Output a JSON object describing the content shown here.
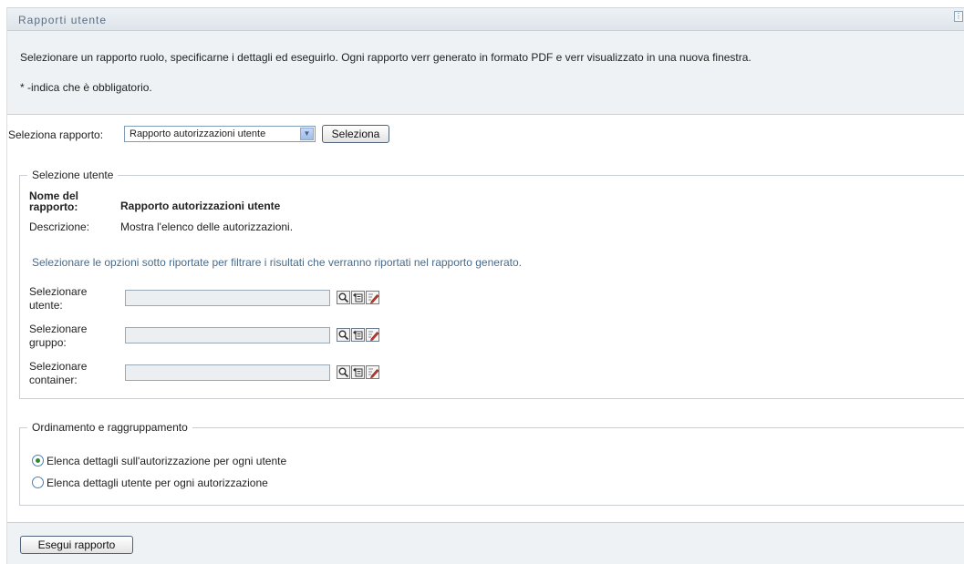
{
  "window": {
    "title": "Rapporti utente"
  },
  "intro": {
    "description": "Selezionare un rapporto ruolo, specificarne i dettagli ed eseguirlo. Ogni rapporto verr generato in formato PDF e verr visualizzato in una nuova finestra.",
    "required_note": "* -indica che è obbligatorio."
  },
  "report_select": {
    "label": "Seleziona rapporto:",
    "selected_value": "Rapporto autorizzazioni utente",
    "button_label": "Seleziona"
  },
  "user_selection": {
    "legend": "Selezione utente",
    "name_label_line1": "Nome del",
    "name_label_line2": "rapporto:",
    "name_value": "Rapporto autorizzazioni utente",
    "description_label": "Descrizione:",
    "description_value": "Mostra l'elenco delle autorizzazioni.",
    "filter_note": "Selezionare le opzioni sotto riportate per filtrare i risultati che verranno riportati nel rapporto generato.",
    "fields": [
      {
        "label_line1": "Selezionare",
        "label_line2": "utente:",
        "value": ""
      },
      {
        "label_line1": "Selezionare",
        "label_line2": "gruppo:",
        "value": ""
      },
      {
        "label_line1": "Selezionare",
        "label_line2": "container:",
        "value": ""
      }
    ]
  },
  "sorting": {
    "legend": "Ordinamento e raggruppamento",
    "options": [
      {
        "label": "Elenca dettagli sull'autorizzazione per ogni utente",
        "selected": true
      },
      {
        "label": "Elenca dettagli utente per ogni autorizzazione",
        "selected": false
      }
    ]
  },
  "footer": {
    "run_button_label": "Esegui rapporto"
  },
  "icons": [
    "menu-icon",
    "search-icon",
    "history-icon",
    "edit-icon",
    "dropdown-arrow-icon"
  ],
  "colors": {
    "title_text": "#5b6d80",
    "panel_background": "#eef2f5",
    "note_text": "#4a6a8a",
    "radio_selected": "#2f8a2f"
  }
}
